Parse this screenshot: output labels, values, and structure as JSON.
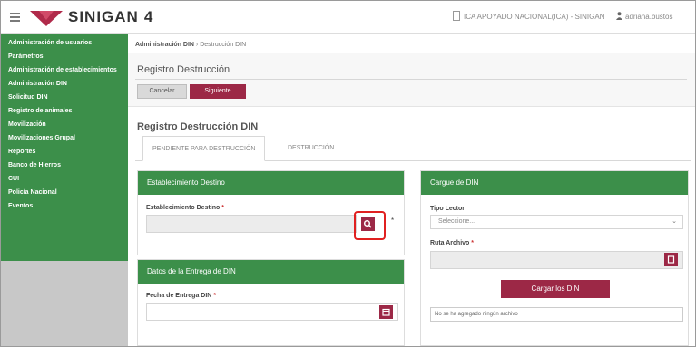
{
  "header": {
    "brand": "SINIGAN",
    "version": "4",
    "organization": "ICA APOYADO NACIONAL(ICA) - SINIGAN",
    "user": "adriana.bustos"
  },
  "sidebar": {
    "items": [
      {
        "label": "Administración de usuarios"
      },
      {
        "label": "Parámetros"
      },
      {
        "label": "Administración de establecimientos"
      },
      {
        "label": "Administración DIN"
      },
      {
        "label": "Solicitud DIN"
      },
      {
        "label": "Registro de animales"
      },
      {
        "label": "Movilización"
      },
      {
        "label": "Movilizaciones Grupal"
      },
      {
        "label": "Reportes"
      },
      {
        "label": "Banco de Hierros"
      },
      {
        "label": "CUI"
      },
      {
        "label": "Policía Nacional"
      },
      {
        "label": "Eventos"
      }
    ]
  },
  "breadcrumb": {
    "parent": "Administración DIN",
    "current": "Destrucción DIN"
  },
  "page": {
    "title": "Registro Destrucción",
    "cancel_label": "Cancelar",
    "next_label": "Siguiente",
    "section_title": "Registro Destrucción DIN",
    "tabs": [
      {
        "label": "PENDIENTE PARA DESTRUCCIÓN",
        "active": true
      },
      {
        "label": "DESTRUCCIÓN",
        "active": false
      }
    ]
  },
  "panel_establecimiento": {
    "title": "Establecimiento Destino",
    "field_label": "Establecimiento Destino",
    "required_mark": "*",
    "value": "",
    "search_icon": "search-icon"
  },
  "panel_fecha": {
    "title": "Datos de la Entrega de DIN",
    "field_label": "Fecha de Entrega DIN",
    "required_mark": "*",
    "value": "",
    "calendar_icon": "calendar-icon"
  },
  "panel_cargue": {
    "title": "Cargue de DIN",
    "tipo_label": "Tipo Lector",
    "tipo_selected": "Seleccione...",
    "ruta_label": "Ruta Archivo",
    "required_mark": "*",
    "load_button": "Cargar los DIN",
    "note": "No se ha agregado ningún archivo"
  },
  "colors": {
    "accent_green": "#3c8f4a",
    "accent_maroon": "#9c2846",
    "highlight_red": "#e02020"
  }
}
